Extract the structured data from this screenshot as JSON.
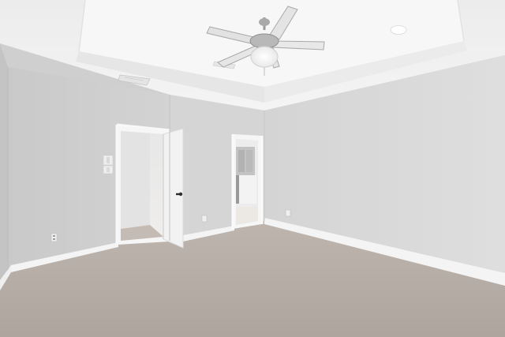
{
  "scene": {
    "kind": "photo",
    "subject": "empty-bedroom-interior",
    "colors": {
      "ceiling": "#f1f1f1",
      "tray_ceiling": "#f6f6f6",
      "left_wall": "#cfcfcf",
      "center_wall": "#d6d6d6",
      "right_wall": "#dadada",
      "trim": "#f7f7f7",
      "carpet": "#b6ada6",
      "door": "#f2f2f2"
    },
    "icons": {
      "ceiling_fan": "ceiling-fan-icon",
      "light_switch": "light-switch-icon",
      "outlet": "outlet-icon",
      "vent": "vent-icon",
      "door_handle": "door-handle-icon"
    }
  }
}
